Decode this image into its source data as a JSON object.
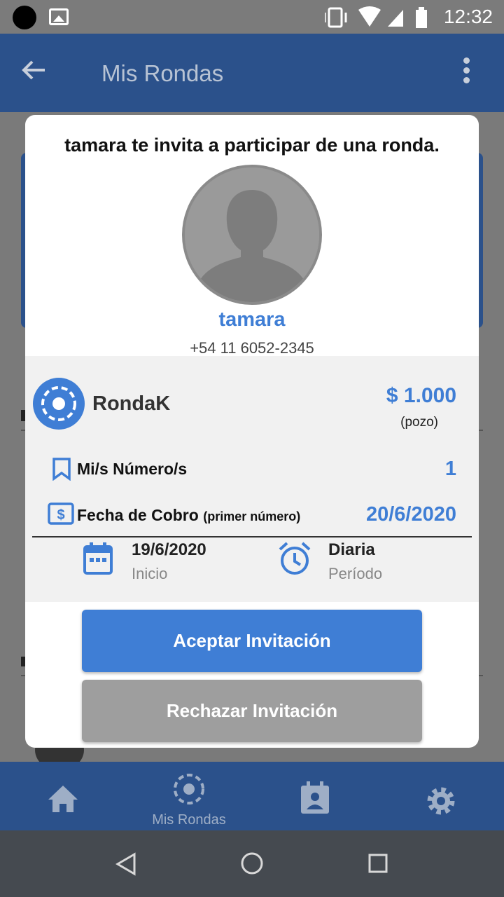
{
  "status_bar": {
    "time": "12:32"
  },
  "app_bar": {
    "title": "Mis Rondas"
  },
  "dialog": {
    "title": "tamara te invita a participar de una ronda.",
    "host": {
      "name": "tamara",
      "phone": "+54 11 6052-2345"
    },
    "ronda": {
      "name": "RondaK",
      "pozo_amount": "$ 1.000",
      "pozo_label": "(pozo)"
    },
    "numeros": {
      "label": "Mi/s Número/s",
      "value": "1"
    },
    "fecha_cobro": {
      "label": "Fecha de Cobro",
      "label_note": "(primer número)",
      "value": "20/6/2020"
    },
    "inicio": {
      "value": "19/6/2020",
      "label": "Inicio"
    },
    "periodo": {
      "value": "Diaria",
      "label": "Período"
    },
    "accept_label": "Aceptar Invitación",
    "reject_label": "Rechazar Invitación"
  },
  "bottom_nav": {
    "active_label": "Mis Rondas"
  },
  "colors": {
    "primary": "#2b518b",
    "accent": "#3f7ed5",
    "reject": "#9e9e9e"
  }
}
